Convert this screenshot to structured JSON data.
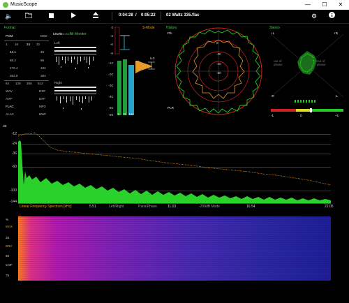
{
  "window": {
    "title": "MusicScope",
    "minimize": "—",
    "maximize": "☐",
    "close": "✕"
  },
  "toolbar": {
    "time_elapsed": "0:04:28",
    "time_sep": "/",
    "time_total": "0:05:22",
    "filename": "02 Waltz 335.flac"
  },
  "format": {
    "title": "Format",
    "pcm": "PCM",
    "dsd": "DSD",
    "bits": [
      "1",
      "16",
      "24",
      "32"
    ],
    "rates_left": [
      "44.1",
      "88.2",
      "176.4",
      "352.8"
    ],
    "rates_right": [
      "48",
      "96",
      "192",
      "384"
    ],
    "dsd_rates": [
      "64",
      "128",
      "256",
      "512"
    ],
    "formats_left": [
      "WAV",
      "AIFF",
      "FLAC",
      "ALAC"
    ],
    "formats_right": [
      "DSF",
      "DFF",
      "MP3",
      "BWF"
    ]
  },
  "levels": {
    "title": "Levels",
    "bit_monitor": "Bit Monitor",
    "bit_monitor_sub": "Bit Monitor",
    "left": "Left",
    "right": "Right"
  },
  "meter": {
    "smode": "S-Mode",
    "scale": [
      "0",
      "-3",
      "-6",
      "-9",
      "-12",
      "-20",
      "-30",
      "-40",
      "-50",
      "-60"
    ],
    "l": "L",
    "r": "R",
    "lu": "LU",
    "peak_value": "5.0"
  },
  "history": {
    "title": "History",
    "pl": "P/L",
    "plr": "PLR",
    "rings": [
      "0",
      "-20",
      "-40",
      "-60"
    ]
  },
  "stereo": {
    "title": "Stereo",
    "plus_l": "+L",
    "plus_r": "+R",
    "minus_l": "-L",
    "minus_r": "-R",
    "out_phase": "out of phase",
    "corr_min": "-1",
    "corr_mid": "0",
    "corr_max": "+1"
  },
  "spectrum": {
    "db_label": "dB",
    "y_ticks": [
      "-12",
      "-24",
      "-36",
      "-60",
      "-100",
      "-144"
    ],
    "x_ticks": [
      "5.51",
      "11.03",
      "16.54",
      "22.05"
    ],
    "labels": [
      "Linear Frequency Spectrum [kHz]",
      "Left/Right",
      "Pans/Phase",
      "-200dB Mode"
    ],
    "colors": {
      "fill": "#2bd12b",
      "peak": "#e89a2a"
    }
  },
  "spectrogram": {
    "y_ticks": [
      "%",
      "MAX",
      "25",
      "BRV",
      "50",
      "COF",
      "75"
    ],
    "colors": {
      "low": "#1f1e9a",
      "mid": "#b21ab0",
      "high": "#ff7a1a"
    }
  }
}
